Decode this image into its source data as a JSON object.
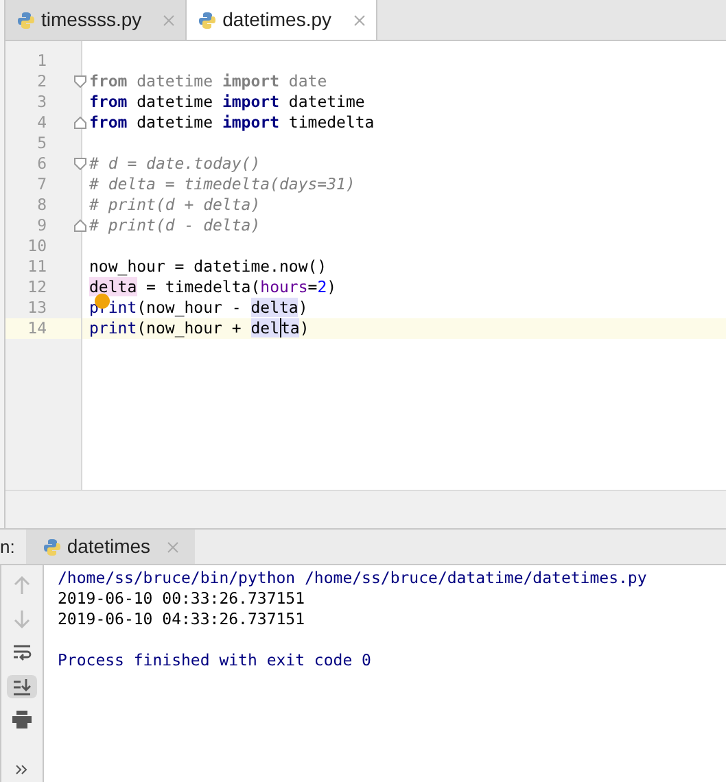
{
  "editor_tabs": [
    {
      "label": "timessss.py",
      "selected": false
    },
    {
      "label": "datetimes.py",
      "selected": true
    }
  ],
  "code_lines": [
    {
      "number": "1"
    },
    {
      "number": "2",
      "fold_start": true,
      "tokens": [
        {
          "text": "from",
          "kind": "dim_keyword"
        },
        {
          "text": " datetime ",
          "kind": "dim"
        },
        {
          "text": "import",
          "kind": "dim_keyword"
        },
        {
          "text": " date",
          "kind": "dim"
        }
      ]
    },
    {
      "number": "3",
      "tokens": [
        {
          "text": "from",
          "kind": "keyword"
        },
        {
          "text": " datetime ",
          "kind": "plain"
        },
        {
          "text": "import",
          "kind": "keyword"
        },
        {
          "text": " datetime",
          "kind": "plain"
        }
      ]
    },
    {
      "number": "4",
      "fold_end": true,
      "tokens": [
        {
          "text": "from",
          "kind": "keyword"
        },
        {
          "text": " datetime ",
          "kind": "plain"
        },
        {
          "text": "import",
          "kind": "keyword"
        },
        {
          "text": " timedelta",
          "kind": "plain"
        }
      ]
    },
    {
      "number": "5"
    },
    {
      "number": "6",
      "fold_start": true,
      "tokens": [
        {
          "text": "# d = date.today()",
          "kind": "comment"
        }
      ]
    },
    {
      "number": "7",
      "tokens": [
        {
          "text": "# delta = timedelta(days=31)",
          "kind": "comment"
        }
      ]
    },
    {
      "number": "8",
      "tokens": [
        {
          "text": "# print(d + delta)",
          "kind": "comment"
        }
      ]
    },
    {
      "number": "9",
      "fold_end": true,
      "tokens": [
        {
          "text": "# print(d - delta)",
          "kind": "comment"
        }
      ]
    },
    {
      "number": "10"
    },
    {
      "number": "11",
      "tokens": [
        {
          "text": "now_hour = datetime.now()",
          "kind": "plain"
        }
      ]
    },
    {
      "number": "12",
      "tokens": [
        {
          "text": "delta",
          "kind": "write_usage"
        },
        {
          "text": " = timedelta(",
          "kind": "plain"
        },
        {
          "text": "hours",
          "kind": "param"
        },
        {
          "text": "=",
          "kind": "plain"
        },
        {
          "text": "2",
          "kind": "number"
        },
        {
          "text": ")",
          "kind": "plain"
        }
      ]
    },
    {
      "number": "13",
      "bulb": true,
      "tokens": [
        {
          "text": "print",
          "kind": "builtin"
        },
        {
          "text": "(now_hour - ",
          "kind": "plain"
        },
        {
          "text": "delta",
          "kind": "read_usage"
        },
        {
          "text": ")",
          "kind": "plain"
        }
      ]
    },
    {
      "number": "14",
      "current": true,
      "tokens": [
        {
          "text": "print",
          "kind": "builtin"
        },
        {
          "text": "(now_hour + ",
          "kind": "plain"
        },
        {
          "text": "del",
          "kind": "read_usage"
        },
        {
          "kind": "caret"
        },
        {
          "text": "ta",
          "kind": "read_usage"
        },
        {
          "text": ")",
          "kind": "plain"
        }
      ]
    }
  ],
  "run_panel": {
    "label": "n:",
    "tab": {
      "label": "datetimes",
      "selected": true
    },
    "tools": [
      {
        "kind": "up",
        "disabled": true
      },
      {
        "kind": "down",
        "disabled": true
      },
      {
        "kind": "wrap",
        "selected": false
      },
      {
        "kind": "scroll_end",
        "selected": true
      },
      {
        "kind": "print",
        "selected": false
      },
      {
        "kind": "more",
        "selected": false
      }
    ],
    "output": [
      {
        "text": "/home/ss/bruce/bin/python /home/ss/bruce/datatime/datetimes.py",
        "kind": "system"
      },
      {
        "text": "2019-06-10 00:33:26.737151",
        "kind": "stdout"
      },
      {
        "text": "2019-06-10 04:33:26.737151",
        "kind": "stdout"
      },
      {
        "kind": "blank"
      },
      {
        "text": "Process finished with exit code 0",
        "kind": "system"
      }
    ]
  }
}
